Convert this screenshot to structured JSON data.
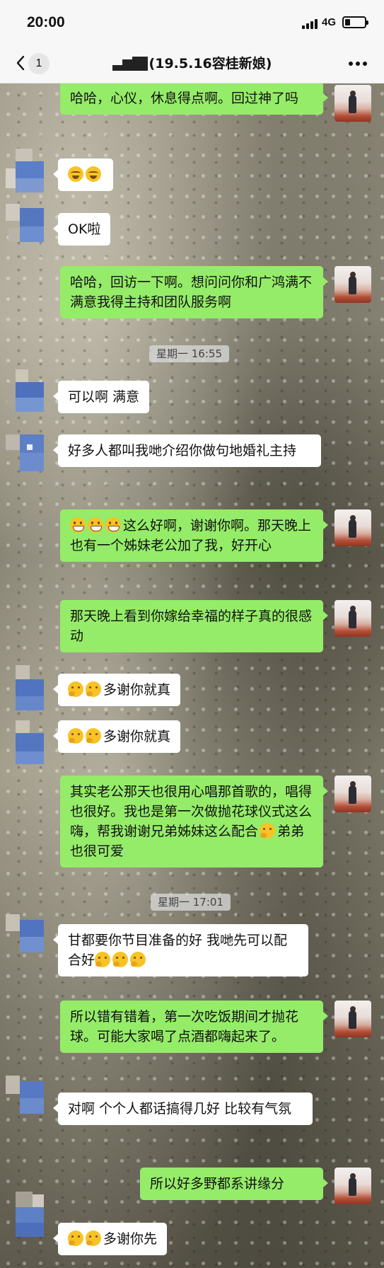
{
  "status_bar": {
    "time": "20:00",
    "network": "4G"
  },
  "nav": {
    "unread_count": "1",
    "title": "(19.5.16容桂新娘)"
  },
  "messages": [
    {
      "side": "right",
      "text": "哈哈，心仪，休息得点啊。回过神了吗"
    },
    {
      "side": "left",
      "emojis": [
        "cry",
        "cry"
      ],
      "text": ""
    },
    {
      "side": "left",
      "text": "OK啦"
    },
    {
      "side": "right",
      "text": "哈哈，回访一下啊。想问问你和广鸿满不满意我得主持和团队服务啊"
    },
    {
      "side": "left",
      "text": "可以啊 满意"
    },
    {
      "side": "left",
      "text": "好多人都叫我哋介绍你做句地婚礼主持"
    },
    {
      "side": "right",
      "emojis": [
        "grin",
        "grin",
        "grin"
      ],
      "text": "这么好啊，谢谢你啊。那天晚上也有一个姊妹老公加了我，好开心"
    },
    {
      "side": "right",
      "text": "那天晚上看到你嫁给幸福的样子真的很感动"
    },
    {
      "side": "left",
      "emojis": [
        "think",
        "think"
      ],
      "text": "多谢你就真"
    },
    {
      "side": "left",
      "emojis": [
        "think",
        "think"
      ],
      "text": "多谢你就真"
    },
    {
      "side": "right",
      "text": "其实老公那天也很用心唱那首歌的，唱得也很好。我也是第一次做抛花球仪式这么嗨，帮我谢谢兄弟姊妹这么配合",
      "inline_emoji": "think",
      "text_after": "弟弟也很可爱"
    },
    {
      "side": "left",
      "text": "甘都要你节目准备的好 我哋先可以配合好",
      "trailing_emojis": [
        "think",
        "think",
        "think"
      ]
    },
    {
      "side": "right",
      "text": "所以错有错着，第一次吃饭期间才抛花球。可能大家喝了点酒都嗨起来了。"
    },
    {
      "side": "left",
      "text": "对啊 个个人都话搞得几好 比较有气氛"
    },
    {
      "side": "right",
      "text": "所以好多野都系讲缘分"
    },
    {
      "side": "left",
      "emojis": [
        "think",
        "think"
      ],
      "text": "多谢你先"
    }
  ],
  "timestamps": [
    {
      "text": "星期一 16:55"
    },
    {
      "text": "星期一 17:01"
    }
  ],
  "icons": {
    "back": "chevron-left-icon",
    "more": "more-dots-icon",
    "signal": "signal-icon",
    "battery": "battery-icon"
  },
  "colors": {
    "bubble_me": "#95ec69",
    "bubble_other": "#ffffff",
    "bar_background": "#f7f7f7"
  }
}
